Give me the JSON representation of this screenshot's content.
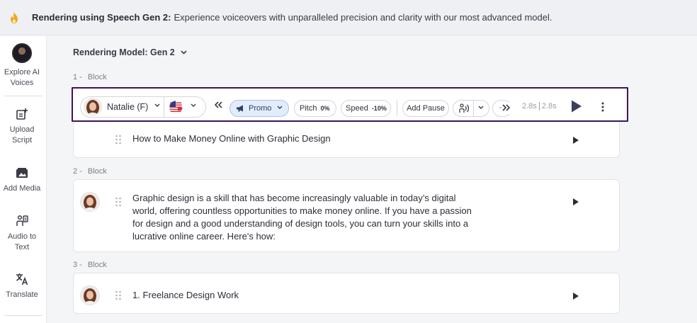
{
  "banner": {
    "icon": "flame-icon",
    "bold_text": "Rendering using Speech Gen 2:",
    "text": "Experience voiceovers with unparalleled precision and clarity with our most advanced model."
  },
  "sidebar": {
    "items": [
      {
        "icon": "avatar-icon",
        "label_line1": "Explore AI",
        "label_line2": "Voices"
      },
      {
        "icon": "upload-script-icon",
        "label_line1": "Upload",
        "label_line2": "Script"
      },
      {
        "icon": "add-media-icon",
        "label_line1": "Add Media",
        "label_line2": ""
      },
      {
        "icon": "audio-to-text-icon",
        "label_line1": "Audio to",
        "label_line2": "Text"
      },
      {
        "icon": "translate-icon",
        "label_line1": "Translate",
        "label_line2": ""
      }
    ]
  },
  "model_selector": {
    "label": "Rendering Model: Gen 2"
  },
  "toolbar": {
    "voice_name": "Natalie (F)",
    "style": "Promo",
    "pitch_label": "Pitch",
    "pitch_value": "0%",
    "speed_label": "Speed",
    "speed_value": "-10%",
    "add_pause": "Add Pause",
    "duration_a": "2.8s",
    "duration_b": "2.8s"
  },
  "blocks": [
    {
      "num": "1 -",
      "label": "Block",
      "text": "How to Make Money Online with Graphic Design"
    },
    {
      "num": "2 -",
      "label": "Block",
      "lines": [
        "Graphic design is a skill that has become increasingly valuable in today’s digital",
        "world, offering countless opportunities to make money online. If you have a passion",
        "for design and a good understanding of design tools, you can turn your skills into a",
        "lucrative online career. Here's how:"
      ]
    },
    {
      "num": "3 -",
      "label": "Block",
      "text": "1. Freelance Design Work"
    }
  ],
  "colors": {
    "highlight_border": "#3d1452",
    "promo_bg": "#e3ecfb",
    "banner_bg": "#eef0f3"
  }
}
